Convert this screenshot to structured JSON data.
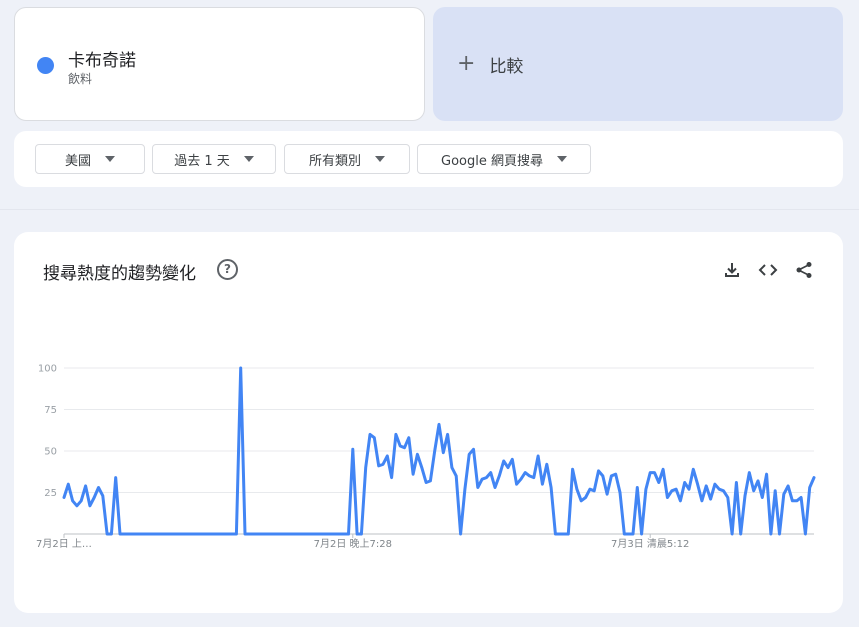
{
  "term": {
    "name": "卡布奇諾",
    "category": "飲料",
    "color": "#4285f4"
  },
  "compare": {
    "plus": "+",
    "label": "比較",
    "bg": "#d9e1f5"
  },
  "filters": [
    {
      "label": "美國"
    },
    {
      "label": "過去 1 天"
    },
    {
      "label": "所有類別"
    },
    {
      "label": "Google 網頁搜尋"
    }
  ],
  "chart": {
    "title": "搜尋熱度的趨勢變化",
    "help": "?"
  },
  "icons": {
    "help": "help-circle-icon",
    "download": "download-icon",
    "embed": "code-icon",
    "share": "share-icon"
  },
  "chart_data": {
    "type": "line",
    "ylim": [
      0,
      100
    ],
    "yticks": [
      "100",
      "75",
      "50",
      "25"
    ],
    "xtick_labels": [
      "7月2日 上…",
      "7月2日 晚上7:28",
      "7月3日 清晨5:12"
    ],
    "xtick_index": [
      0,
      67,
      136
    ],
    "grid": true,
    "series": [
      {
        "color": "#4285f4",
        "values": [
          22,
          30,
          20,
          17,
          20,
          29,
          17,
          22,
          28,
          23,
          0,
          0,
          34,
          0,
          0,
          0,
          0,
          0,
          0,
          0,
          0,
          0,
          0,
          0,
          0,
          0,
          0,
          0,
          0,
          0,
          0,
          0,
          0,
          0,
          0,
          0,
          0,
          0,
          0,
          0,
          0,
          100,
          0,
          0,
          0,
          0,
          0,
          0,
          0,
          0,
          0,
          0,
          0,
          0,
          0,
          0,
          0,
          0,
          0,
          0,
          0,
          0,
          0,
          0,
          0,
          0,
          0,
          51,
          0,
          0,
          40,
          60,
          58,
          41,
          42,
          47,
          34,
          60,
          53,
          52,
          58,
          36,
          48,
          40,
          31,
          32,
          50,
          66,
          49,
          60,
          40,
          35,
          0,
          27,
          48,
          51,
          28,
          33,
          34,
          37,
          28,
          35,
          44,
          40,
          45,
          30,
          33,
          37,
          35,
          34,
          47,
          30,
          42,
          28,
          0,
          0,
          0,
          0,
          39,
          27,
          20,
          22,
          27,
          26,
          38,
          35,
          24,
          35,
          36,
          25,
          0,
          0,
          0,
          28,
          0,
          27,
          37,
          37,
          31,
          39,
          22,
          26,
          27,
          20,
          31,
          27,
          39,
          30,
          20,
          29,
          21,
          30,
          27,
          26,
          22,
          0,
          31,
          0,
          23,
          37,
          26,
          32,
          22,
          36,
          0,
          26,
          0,
          24,
          29,
          20,
          20,
          22,
          0,
          28,
          34
        ]
      }
    ]
  }
}
